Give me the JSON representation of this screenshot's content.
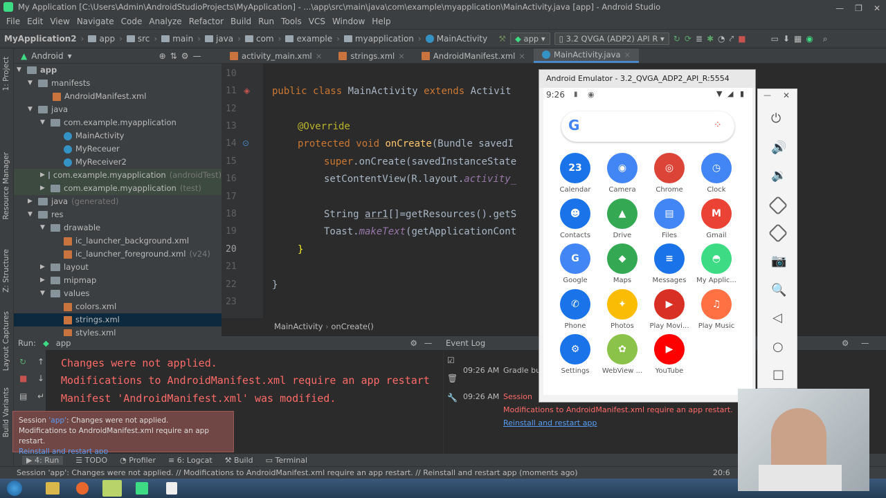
{
  "window": {
    "title": "My Application [C:\\Users\\Admin\\AndroidStudioProjects\\MyApplication] - ...\\app\\src\\main\\java\\com\\example\\myapplication\\MainActivity.java [app] - Android Studio"
  },
  "menu": [
    "File",
    "Edit",
    "View",
    "Navigate",
    "Code",
    "Analyze",
    "Refactor",
    "Build",
    "Run",
    "Tools",
    "VCS",
    "Window",
    "Help"
  ],
  "breadcrumb": [
    "MyApplication2",
    "app",
    "src",
    "main",
    "java",
    "com",
    "example",
    "myapplication",
    "MainActivity"
  ],
  "toolbar": {
    "run_config": "app",
    "device": "3.2  QVGA (ADP2) API R"
  },
  "sidebar_labels": {
    "project": "1: Project",
    "resource_manager": "Resource Manager",
    "structure": "Z: Structure",
    "layout_captures": "Layout Captures",
    "build_variants": "Build Variants",
    "favorites": "2: Favorites",
    "device_explorer": "Device File Explorer"
  },
  "project": {
    "view": "Android",
    "tree": [
      {
        "label": "app",
        "depth": 0
      },
      {
        "label": "manifests",
        "depth": 1
      },
      {
        "label": "AndroidManifest.xml",
        "depth": 2
      },
      {
        "label": "java",
        "depth": 1
      },
      {
        "label": "com.example.myapplication",
        "depth": 2
      },
      {
        "label": "MainActivity",
        "depth": 3
      },
      {
        "label": "MyReceuer",
        "depth": 3
      },
      {
        "label": "MyReceiver2",
        "depth": 3
      },
      {
        "label": "com.example.myapplication",
        "depth": 2,
        "suffix": "(androidTest)"
      },
      {
        "label": "com.example.myapplication",
        "depth": 2,
        "suffix": "(test)"
      },
      {
        "label": "java",
        "depth": 1,
        "suffix": "(generated)"
      },
      {
        "label": "res",
        "depth": 1
      },
      {
        "label": "drawable",
        "depth": 2
      },
      {
        "label": "ic_launcher_background.xml",
        "depth": 3
      },
      {
        "label": "ic_launcher_foreground.xml",
        "depth": 3,
        "suffix": "(v24)"
      },
      {
        "label": "layout",
        "depth": 2
      },
      {
        "label": "mipmap",
        "depth": 2
      },
      {
        "label": "values",
        "depth": 2
      },
      {
        "label": "colors.xml",
        "depth": 3
      },
      {
        "label": "strings.xml",
        "depth": 3
      },
      {
        "label": "styles.xml",
        "depth": 3
      }
    ]
  },
  "editor": {
    "tabs": [
      "activity_main.xml",
      "strings.xml",
      "AndroidManifest.xml",
      "MainActivity.java"
    ],
    "line_numbers": [
      "10",
      "11",
      "12",
      "13",
      "14",
      "15",
      "16",
      "17",
      "18",
      "19",
      "20",
      "21",
      "22",
      "23"
    ],
    "code": {
      "l11a": "public class ",
      "l11b": "MainActivity ",
      "l11c": "extends ",
      "l11d": "Activit",
      "l13": "@Override",
      "l14a": "protected void ",
      "l14b": "onCreate",
      "l14c": "(Bundle savedI",
      "l15a": "super",
      "l15b": ".onCreate(savedInstanceState",
      "l16a": "setContentView(R.layout.",
      "l16b": "activity_",
      "l18a": "String ",
      "l18b": "arr1",
      "l18c": "[]=getResources().getS",
      "l19a": "Toast.",
      "l19b": "makeText",
      "l19c": "(getApplicationCont",
      "l20": "}",
      "l22": "}"
    },
    "breadcrumb": [
      "MainActivity",
      "onCreate()"
    ]
  },
  "run": {
    "title": "Run:",
    "config": "app",
    "lines": [
      "Changes were not applied.",
      "Modifications to AndroidManifest.xml require an app restart",
      "Manifest 'AndroidManifest.xml' was modified."
    ]
  },
  "event_log": {
    "title": "Event Log",
    "entries": [
      {
        "time": "09:26 AM",
        "text": "Gradle buil"
      },
      {
        "time": "09:26 AM",
        "text": "Session",
        "detail": "Modifications to AndroidManifest.xml require an app restart.",
        "link": "Reinstall and restart app"
      }
    ]
  },
  "toast": {
    "line1a": "Session ",
    "line1b": "'app'",
    "line1c": ": Changes were not applied.",
    "line2": "Modifications to AndroidManifest.xml require an app restart.",
    "link": "Reinstall and restart app"
  },
  "bottom_tabs": [
    "4: Run",
    "TODO",
    "Profiler",
    "6: Logcat",
    "Build",
    "Terminal"
  ],
  "status": {
    "text": "Session 'app': Changes were not applied. // Modifications to AndroidManifest.xml require an app restart. // Reinstall and restart app (moments ago)",
    "position": "20:6"
  },
  "emulator": {
    "title": "Android Emulator - 3.2_QVGA_ADP2_API_R:5554",
    "time": "9:26",
    "apps": [
      {
        "name": "Calendar",
        "color": "#1a73e8",
        "glyph": "23"
      },
      {
        "name": "Camera",
        "color": "#4285f4",
        "glyph": "◉"
      },
      {
        "name": "Chrome",
        "color": "#db4437",
        "glyph": "◎"
      },
      {
        "name": "Clock",
        "color": "#4285f4",
        "glyph": "◷"
      },
      {
        "name": "Contacts",
        "color": "#1a73e8",
        "glyph": "☻"
      },
      {
        "name": "Drive",
        "color": "#34a853",
        "glyph": "▲"
      },
      {
        "name": "Files",
        "color": "#4285f4",
        "glyph": "▤"
      },
      {
        "name": "Gmail",
        "color": "#ea4335",
        "glyph": "M"
      },
      {
        "name": "Google",
        "color": "#4285f4",
        "glyph": "G"
      },
      {
        "name": "Maps",
        "color": "#34a853",
        "glyph": "◆"
      },
      {
        "name": "Messages",
        "color": "#1a73e8",
        "glyph": "≡"
      },
      {
        "name": "My Applic...",
        "color": "#3ddc84",
        "glyph": "◓"
      },
      {
        "name": "Phone",
        "color": "#1a73e8",
        "glyph": "✆"
      },
      {
        "name": "Photos",
        "color": "#fbbc05",
        "glyph": "✦"
      },
      {
        "name": "Play Movi...",
        "color": "#d93025",
        "glyph": "▶"
      },
      {
        "name": "Play Music",
        "color": "#ff7043",
        "glyph": "♫"
      },
      {
        "name": "Settings",
        "color": "#1a73e8",
        "glyph": "⚙"
      },
      {
        "name": "WebView ...",
        "color": "#8bc34a",
        "glyph": "✿"
      },
      {
        "name": "YouTube",
        "color": "#ff0000",
        "glyph": "▶"
      }
    ]
  }
}
